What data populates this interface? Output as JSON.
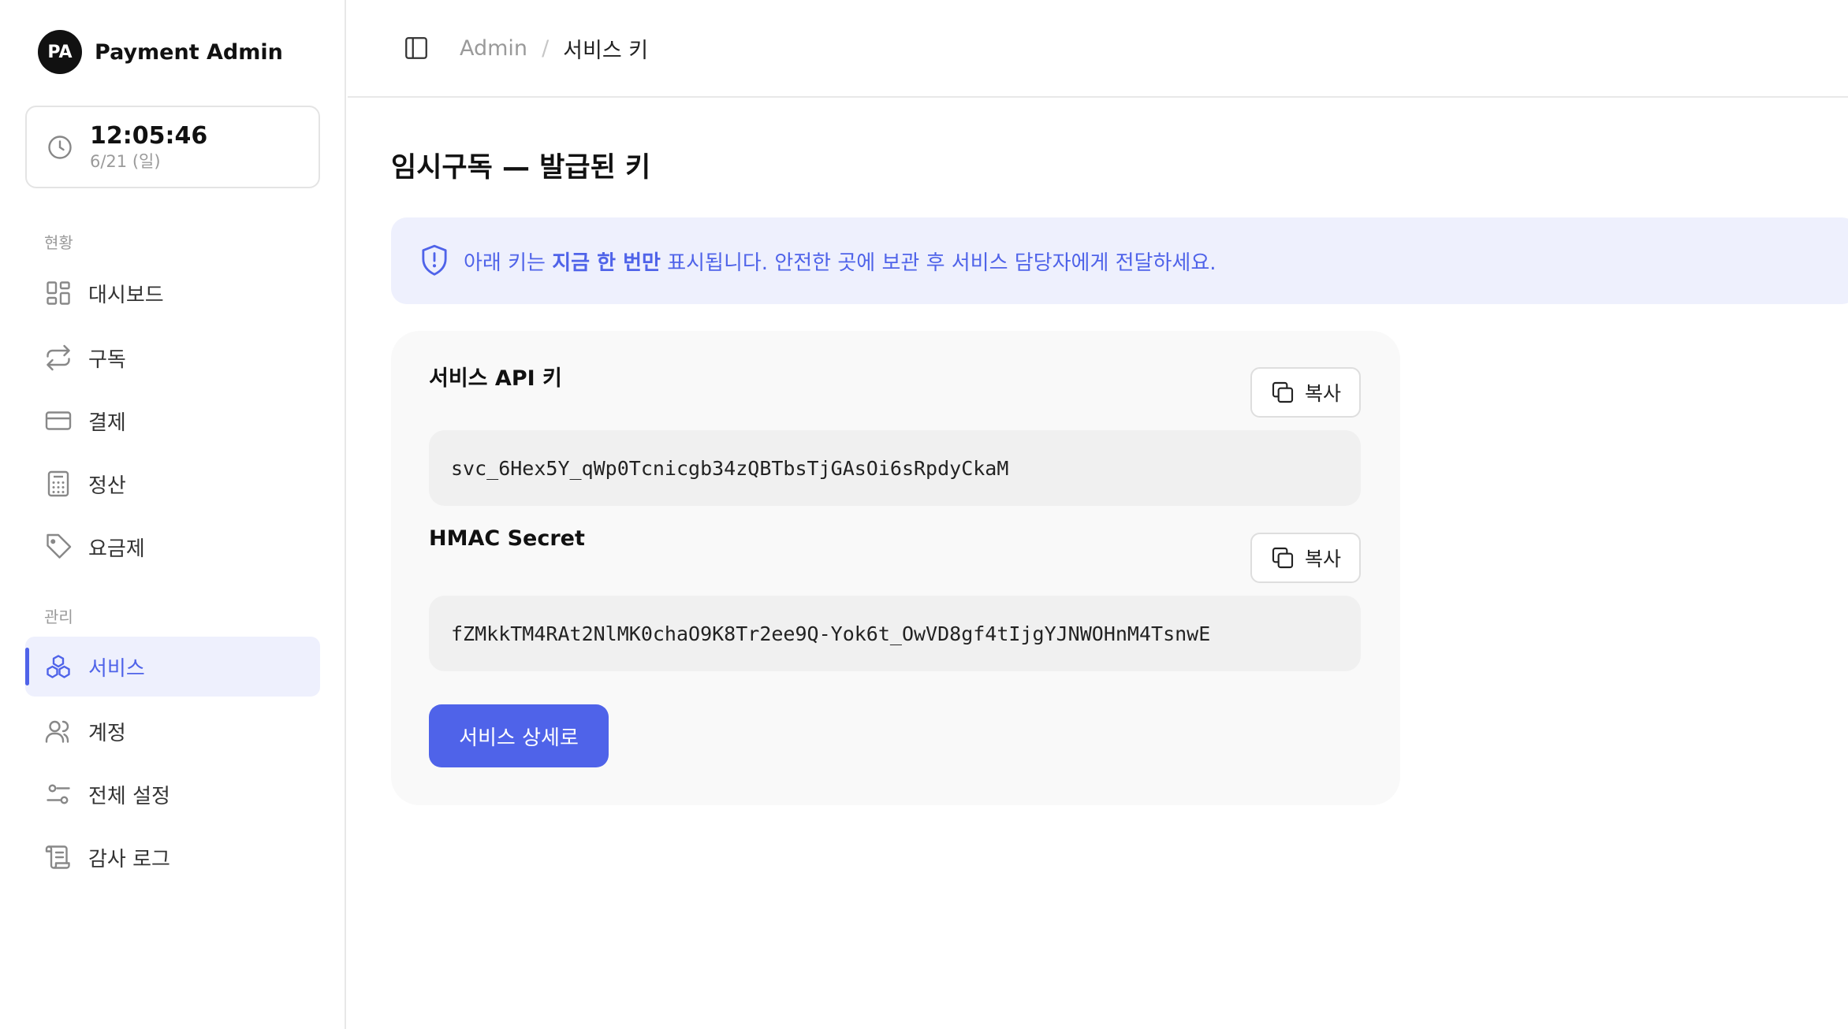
{
  "brand": {
    "initials": "PA",
    "name": "Payment Admin"
  },
  "clock": {
    "time": "12:05:46",
    "date": "6/21 (일)"
  },
  "sidebar": {
    "groups": [
      {
        "title": "현황",
        "items": [
          {
            "label": "대시보드",
            "icon": "dashboard-grid-icon"
          },
          {
            "label": "구독",
            "icon": "repeat-arrows-icon"
          },
          {
            "label": "결제",
            "icon": "credit-card-icon"
          },
          {
            "label": "정산",
            "icon": "calculator-icon"
          },
          {
            "label": "요금제",
            "icon": "tag-icon"
          }
        ]
      },
      {
        "title": "관리",
        "items": [
          {
            "label": "서비스",
            "icon": "boxes-icon",
            "active": true
          },
          {
            "label": "계정",
            "icon": "users-icon"
          },
          {
            "label": "전체 설정",
            "icon": "sliders-icon"
          },
          {
            "label": "감사 로그",
            "icon": "scroll-icon"
          }
        ]
      }
    ]
  },
  "header": {
    "breadcrumb": {
      "root": "Admin",
      "separator": "/",
      "current": "서비스 키"
    }
  },
  "main": {
    "title": "임시구독 — 발급된 키",
    "notice": {
      "prefix": "아래 키는 ",
      "emphasis": "지금 한 번만",
      "suffix": " 표시됩니다. 안전한 곳에 보관 후 서비스 담당자에게 전달하세요."
    },
    "keys": [
      {
        "label": "서비스 API 키",
        "value": "svc_6Hex5Y_qWp0Tcnicgb34zQBTbsTjGAsOi6sRpdyCkaM",
        "copy_label": "복사"
      },
      {
        "label": "HMAC Secret",
        "value": "fZMkkTM4RAt2NlMK0chaO9K8Tr2ee9Q-Yok6t_OwVD8gf4tIjgYJNWOHnM4TsnwE",
        "copy_label": "복사"
      }
    ],
    "primary_button": "서비스 상세로"
  },
  "colors": {
    "accent": "#4f63e9",
    "accent_bg": "#eef0fd",
    "border": "#e8e8e8"
  }
}
